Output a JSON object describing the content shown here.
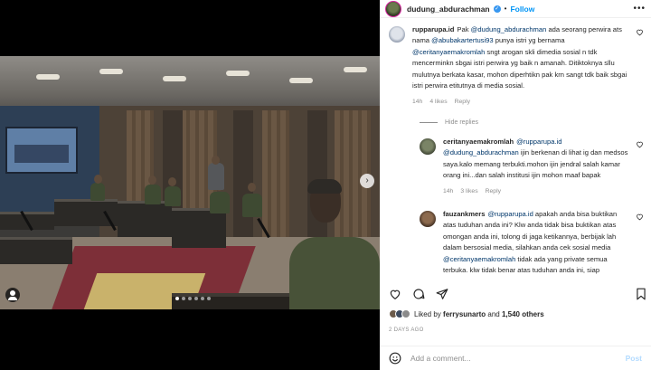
{
  "post": {
    "username": "dudung_abdurachman",
    "verified": "✓",
    "separator": "•",
    "follow_label": "Follow",
    "more_label": "•••",
    "nav_next": "›"
  },
  "comments": [
    {
      "user": "ruppa​rupa.id",
      "segments": [
        {
          "t": "Pak ",
          "m": false
        },
        {
          "t": "@dudung_abdurachman",
          "m": true
        },
        {
          "t": " ada seorang perwira ats nama ",
          "m": false
        },
        {
          "t": "@abubakartertusi93",
          "m": true
        },
        {
          "t": " punya istri yg bernama ",
          "m": false
        },
        {
          "t": "@ceritanyaemakromlah",
          "m": true
        },
        {
          "t": " sngt arogan skli dimedia sosial n tdk mencerminkn sbgai istri perwira yg baik n amanah. Ditiktoknya sllu mulutnya berkata kasar, mohon diperhtikn pak krn sangt tdk baik sbgai istri perwira etitutnya di media sosial.",
          "m": false
        }
      ],
      "time": "14h",
      "likes": "4 likes",
      "reply": "Reply"
    },
    {
      "user": "ceritanyaemakromlah",
      "segments": [
        {
          "t": "@ruppa​rupa.id",
          "m": true
        },
        {
          "t": " ",
          "m": false
        },
        {
          "t": "@dudung_abdurachman",
          "m": true
        },
        {
          "t": " ijin berkenan di lihat ig dan medsos saya.kalo memang terbukti.mohon ijin jendral salah kamar orang ini...dan salah institusi ijin mohon maaf bapak",
          "m": false
        }
      ],
      "time": "14h",
      "likes": "3 likes",
      "reply": "Reply"
    },
    {
      "user": "fauzankmers",
      "segments": [
        {
          "t": "@ruppa​rupa.id",
          "m": true
        },
        {
          "t": " apakah anda bisa buktikan atas tuduhan anda ini? Klw anda tidak bisa buktikan atas omongan anda ini, tolong di jaga ketikannya, berbijak lah dalam bersosial media, silahkan anda cek sosial media ",
          "m": false
        },
        {
          "t": "@ceritanyaemakromlah",
          "m": true
        },
        {
          "t": " tidak ada yang private semua terbuka. klw tidak benar atas tuduhan anda ini, siap",
          "m": false
        }
      ],
      "time": "",
      "likes": "",
      "reply": ""
    }
  ],
  "hide_replies_label": "Hide replies",
  "likes_summary": {
    "prefix": "Liked by ",
    "user": "ferrysunarto",
    "mid": " and ",
    "count": "1,540 others"
  },
  "timestamp": "2 DAYS AGO",
  "composer": {
    "placeholder": "Add a comment...",
    "post_label": "Post"
  },
  "carousel": {
    "total": 6,
    "active": 0
  },
  "colors": {
    "accent": "#0095f6",
    "mention": "#00376b",
    "muted": "#8e8e8e"
  }
}
